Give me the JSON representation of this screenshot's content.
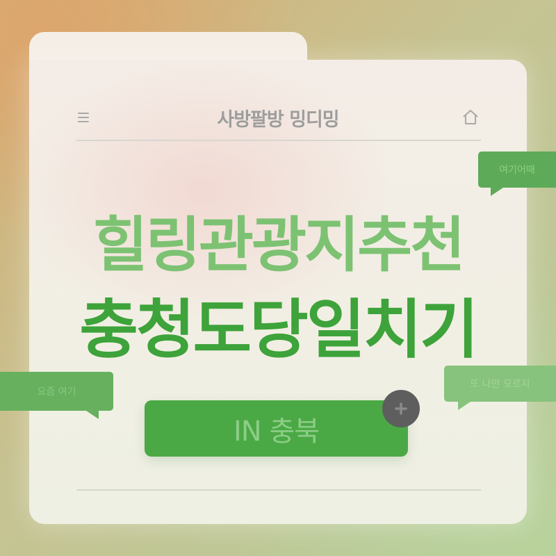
{
  "header": {
    "title": "사방팔방 밍디밍",
    "menu_icon": "hamburger-menu-icon",
    "home_icon": "home-icon"
  },
  "headline": {
    "line1": "힐링관광지추천",
    "line2": "충청도당일치기"
  },
  "bubbles": [
    {
      "text": "여기어때"
    },
    {
      "text": "요즘 여기"
    },
    {
      "text": "또 나만 모르지"
    }
  ],
  "cta": {
    "label": "IN 충북",
    "plus_icon": "plus-icon"
  },
  "colors": {
    "accent_dark": "#3da33a",
    "accent_light": "#7cc272",
    "button": "#4aa945",
    "plus_button": "#5e5e5e"
  }
}
